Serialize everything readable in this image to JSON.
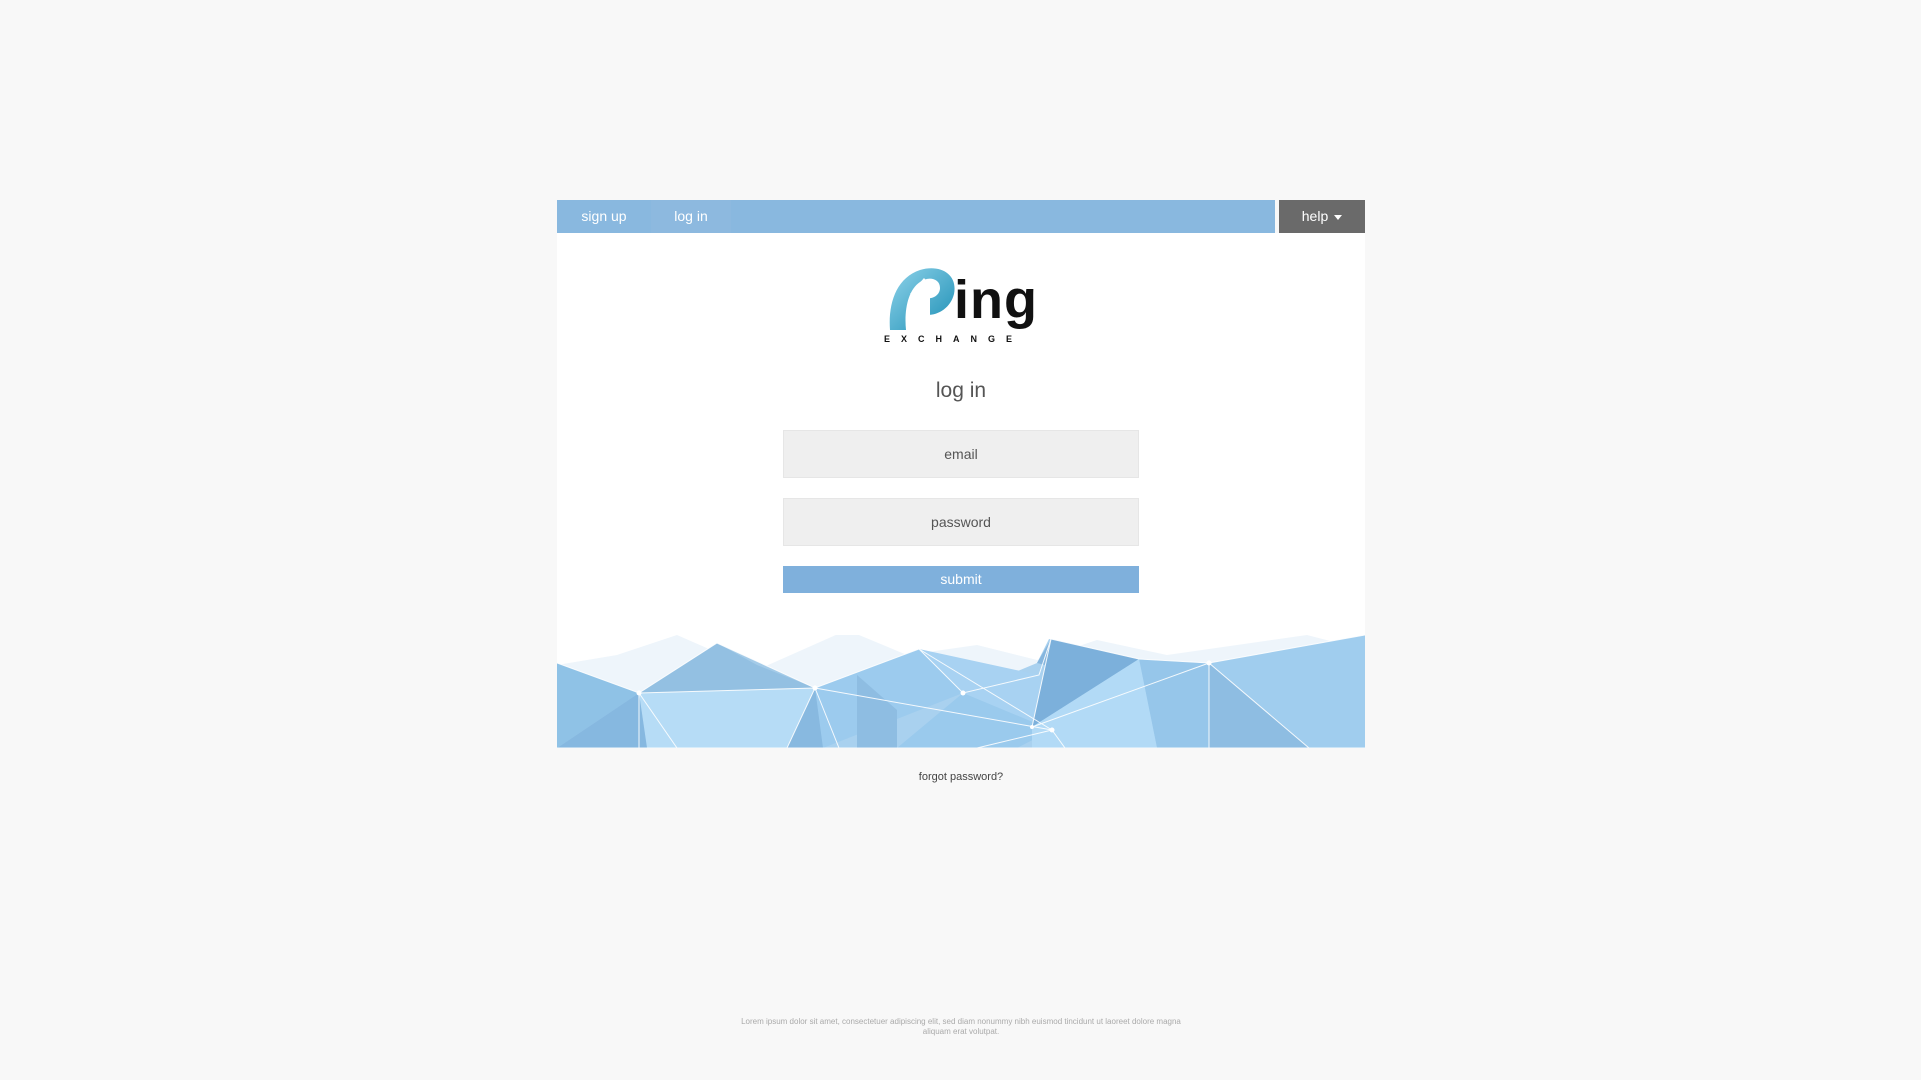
{
  "nav": {
    "tabs": [
      {
        "label": "sign up"
      },
      {
        "label": "log in"
      }
    ],
    "help_label": "help",
    "help_icon": "caret-down-icon"
  },
  "logo": {
    "word": "ing",
    "subtitle": "EXCHANGE"
  },
  "form": {
    "title": "log in",
    "email_placeholder": "email",
    "password_placeholder": "password",
    "submit_label": "submit"
  },
  "forgot_label": "forgot password?",
  "footer_text": "Lorem ipsum dolor sit amet, consectetuer adipiscing elit, sed diam nonummy nibh euismod tincidunt ut laoreet dolore magna aliquam erat volutpat.",
  "colors": {
    "nav_bar": "#89b8df",
    "help_button": "#6a6a6a",
    "submit_button": "#7fb0dc",
    "background": "#f8f8f8"
  }
}
